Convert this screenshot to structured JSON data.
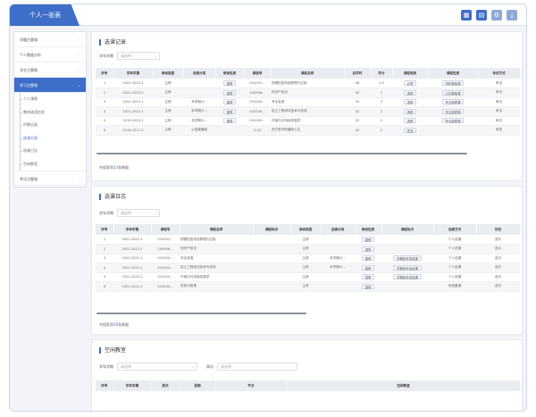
{
  "app": {
    "title": "个人一张表"
  },
  "topbar": {
    "icons": [
      "grid-icon",
      "layout-icon",
      "settings-icon",
      "download-icon"
    ]
  },
  "sidebar": {
    "items": [
      {
        "label": "学籍主题域"
      },
      {
        "label": "个人数据分析"
      },
      {
        "label": "学业主题域"
      },
      {
        "label": "学习主题域"
      },
      {
        "label": "考试主题域"
      }
    ],
    "subitems": [
      "个人课表",
      "教材选用信息",
      "评教记录",
      "选课记录",
      "选课日志",
      "空闲教室"
    ]
  },
  "panel1": {
    "title": "选课记录",
    "filter_label": "学年学期",
    "filter_placeholder": "请选择",
    "columns": [
      "序号",
      "学年学期",
      "修读类型",
      "选课分类",
      "修读性质",
      "课程号",
      "课程名称",
      "总学时",
      "学分",
      "课程类别",
      "课程性质",
      "考试方式"
    ],
    "rows": [
      [
        "1",
        "2021-2022-2",
        "主修",
        "",
        "重修",
        "010201...",
        "物理信息系统原理与应用",
        "48",
        "2.5",
        "必修",
        "学科基础课",
        "考试"
      ],
      [
        "2",
        "2021-2022-2",
        "主修",
        "",
        "重修",
        "200906...",
        "知识产权法",
        "32",
        "2",
        "选修",
        "公共基础课",
        "考试"
      ],
      [
        "3",
        "2021-2022-1",
        "主修",
        "本学期计...",
        "重修",
        "010200...",
        "专业英语",
        "32",
        "2",
        "选修",
        "专业选修课",
        "考试"
      ],
      [
        "4",
        "2021-2022-1",
        "主修",
        "本学期计...",
        "重修",
        "010200...",
        "岩土工程测试技术与检测",
        "32",
        "2",
        "选修",
        "专业选修课",
        "考试"
      ],
      [
        "5",
        "2019-2020-1",
        "主修",
        "本学期计...",
        "重修",
        "010200...",
        "环境与可持续发展学",
        "32",
        "2",
        "选修",
        "专业选修课",
        "考试"
      ],
      [
        "6",
        "2016-2017-2",
        "主修",
        "公选课通道",
        "",
        "2-15",
        "西方哲学的趣味人生",
        "32",
        "2",
        "任选",
        "",
        "考查"
      ]
    ],
    "total_prefix": "共搜索到",
    "total_count": "23",
    "total_suffix": "条数据"
  },
  "panel2": {
    "title": "选课日志",
    "filter_label": "学年学期",
    "filter_placeholder": "请选择",
    "columns": [
      "序号",
      "学年学期",
      "课程号",
      "课程名称",
      "课程标示",
      "修读类型",
      "选课分类",
      "修读性质",
      "课程轮次",
      "选课方式",
      "状态"
    ],
    "rows": [
      [
        "1",
        "2021-2022-2",
        "010201...",
        "物理信息系统原理与应用",
        "",
        "主修",
        "",
        "重修",
        "",
        "个人选课",
        "选中"
      ],
      [
        "2",
        "2021-2022-2",
        "200906...",
        "知识产权法",
        "",
        "主修",
        "",
        "重修",
        "",
        "个人选课",
        "选中"
      ],
      [
        "3",
        "2021-2022-1",
        "010200...",
        "专业英语",
        "",
        "主修",
        "本学期计...",
        "重修",
        "学期轮补选选课",
        "个人选课",
        "选中"
      ],
      [
        "4",
        "2021-2022-1",
        "010200...",
        "岩土工程测试技术与检测",
        "",
        "主修",
        "本学期计...",
        "重修",
        "学期轮补选选课",
        "个人选课",
        "选中"
      ],
      [
        "5",
        "2021-2022-1",
        "010200...",
        "环境与可持续发展学",
        "",
        "主修",
        "",
        "重修",
        "学期轮补选选课",
        "个人选课",
        "选中"
      ],
      [
        "6",
        "2021-2022-1",
        "010400...",
        "采质与政策",
        "",
        "主修",
        "",
        "重修",
        "",
        "系统置课",
        "选中"
      ]
    ],
    "total_prefix": "共搜索到",
    "total_count": "56",
    "total_suffix": "条数据"
  },
  "panel3": {
    "title": "空闲教室",
    "filter_label": "学年学期",
    "filter_placeholder": "请选择",
    "filter2_label": "周次",
    "filter2_placeholder": "请选择",
    "columns": [
      "序号",
      "学年学期",
      "周次",
      "星期",
      "节次",
      "空闲教室"
    ]
  }
}
